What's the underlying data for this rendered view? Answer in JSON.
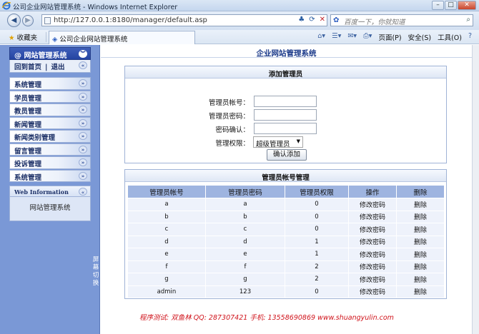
{
  "browser": {
    "window_title": "公司企业网站管理系统 - Windows Internet Explorer",
    "url": "http://127.0.0.1:8180/manager/default.asp",
    "search_placeholder": "百度一下，你就知道",
    "favorites_label": "收藏夹",
    "tab_title": "公司企业网站管理系统",
    "commands": {
      "page": "页面(P)",
      "safety": "安全(S)",
      "tools": "工具(O)",
      "help": "?"
    }
  },
  "sidebar": {
    "title": "@ 网站管理系统",
    "home_link": "回到首页",
    "separator": "|",
    "logout_link": "退出",
    "menu": [
      {
        "label": "系统管理"
      },
      {
        "label": "学员管理"
      },
      {
        "label": "教员管理"
      },
      {
        "label": "新闻管理"
      },
      {
        "label": "新闻类别管理"
      },
      {
        "label": "留言管理"
      },
      {
        "label": "投诉管理"
      },
      {
        "label": "系统管理"
      }
    ],
    "info_title": "Web Information",
    "info_text": "网站管理系统",
    "toggle_text": "屏幕切换"
  },
  "main": {
    "page_title": "企业网站管理系统",
    "add_admin": {
      "title": "添加管理员",
      "account_label": "管理员帐号：",
      "account_value": "",
      "password_label": "管理员密码：",
      "password_value": "",
      "confirm_label": "密码确认：",
      "confirm_value": "",
      "role_label": "管理权限：",
      "role_selected": "超级管理员",
      "submit_label": "确认添加"
    },
    "admin_list": {
      "title": "管理员帐号管理",
      "columns": [
        "管理员帐号",
        "管理员密码",
        "管理员权限",
        "操作",
        "删除"
      ],
      "rows": [
        {
          "account": "a",
          "password": "a",
          "role": "0",
          "action": "修改密码",
          "delete": "删除"
        },
        {
          "account": "b",
          "password": "b",
          "role": "0",
          "action": "修改密码",
          "delete": "删除"
        },
        {
          "account": "c",
          "password": "c",
          "role": "0",
          "action": "修改密码",
          "delete": "删除"
        },
        {
          "account": "d",
          "password": "d",
          "role": "1",
          "action": "修改密码",
          "delete": "删除"
        },
        {
          "account": "e",
          "password": "e",
          "role": "1",
          "action": "修改密码",
          "delete": "删除"
        },
        {
          "account": "f",
          "password": "f",
          "role": "2",
          "action": "修改密码",
          "delete": "删除"
        },
        {
          "account": "g",
          "password": "g",
          "role": "2",
          "action": "修改密码",
          "delete": "删除"
        },
        {
          "account": "admin",
          "password": "123",
          "role": "0",
          "action": "修改密码",
          "delete": "删除"
        }
      ]
    },
    "footer": "程序测试: 双鱼林  QQ: 287307421  手机: 13558690869  www.shuangyulin.com"
  },
  "colors": {
    "sidebar_bg": "#7a98d6",
    "sidebar_header": "#2444a2",
    "table_header": "#9eb4e0",
    "table_cell": "#eef2fb",
    "footer_text": "#d0131b"
  }
}
